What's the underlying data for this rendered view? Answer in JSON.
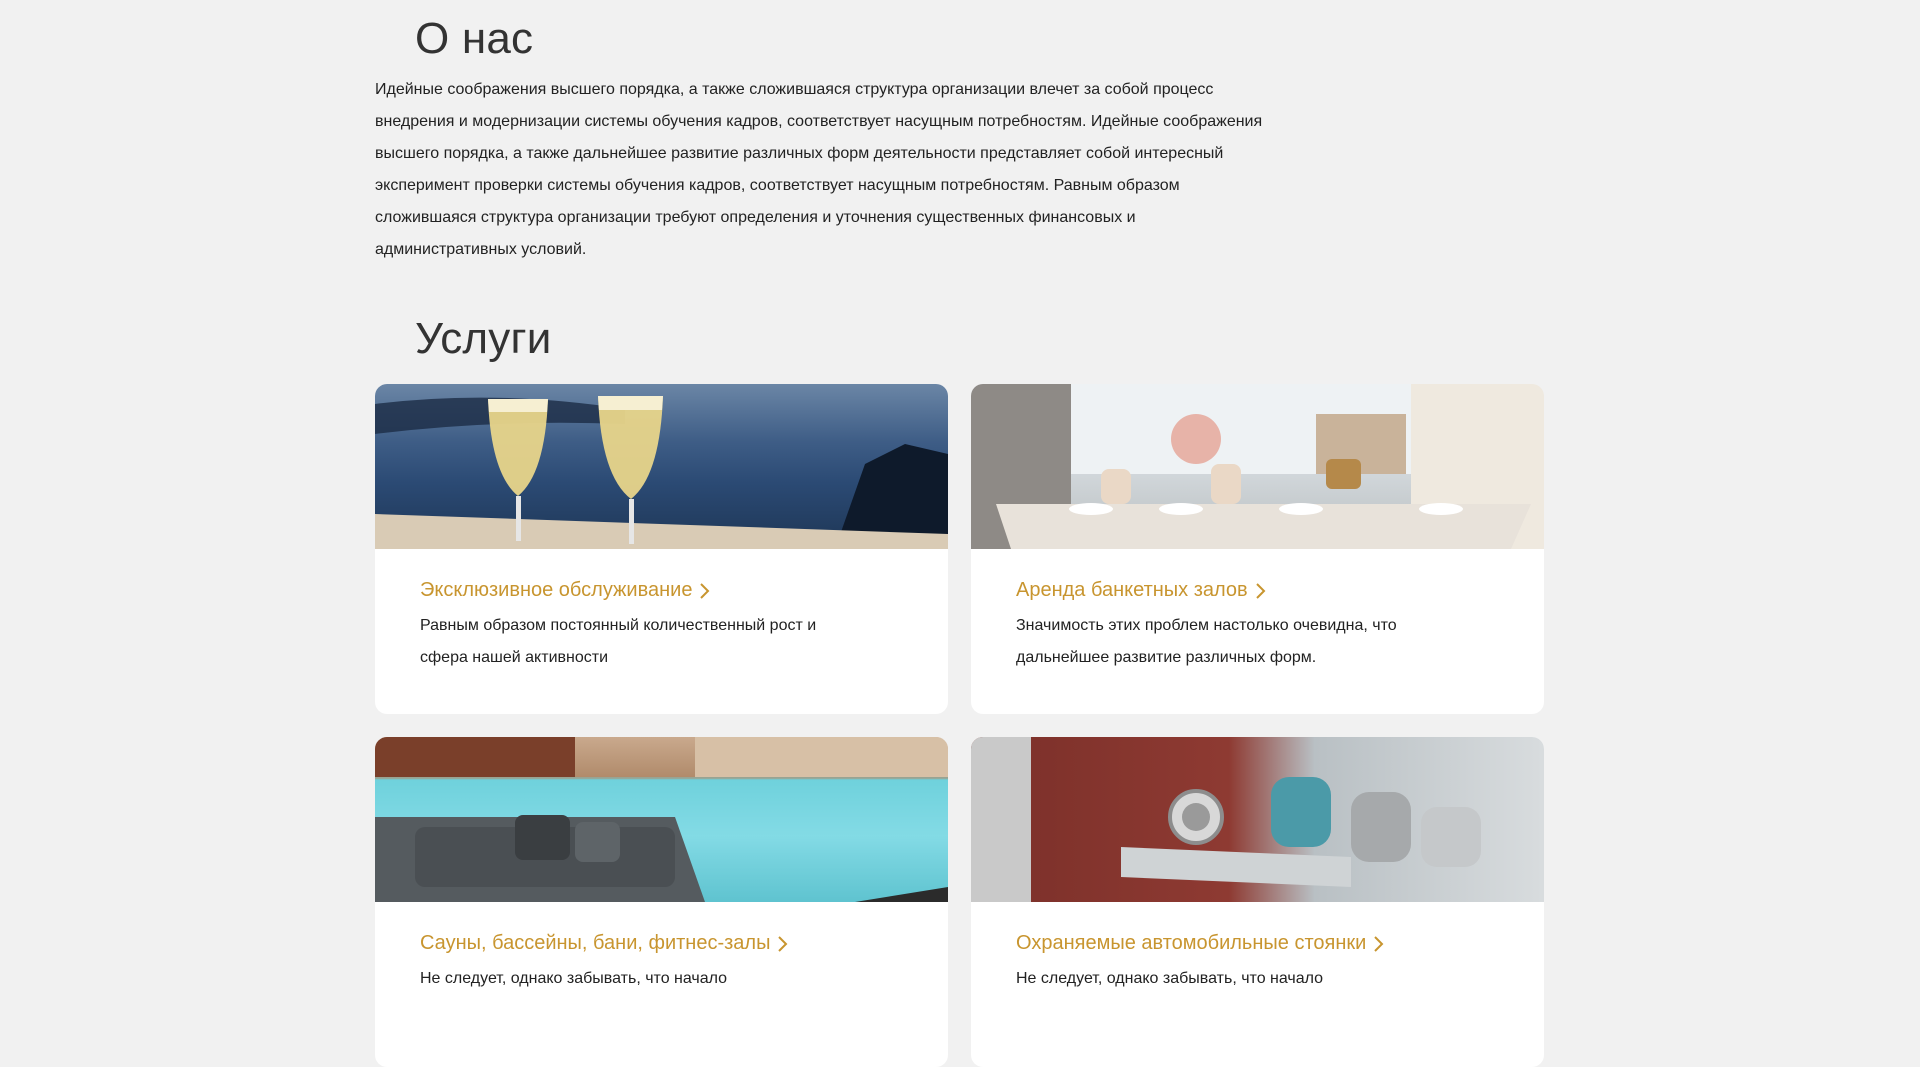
{
  "about": {
    "title": "О нас",
    "text": "Идейные соображения высшего порядка, а также сложившаяся структура организации влечет за собой процесс внедрения и модернизации системы обучения кадров, соответствует насущным потребностям. Идейные соображения высшего порядка, а также дальнейшее развитие различных форм деятельности представляет собой интересный эксперимент проверки системы обучения кадров, соответствует насущным потребностям. Равным образом сложившаяся структура организации требуют определения и уточнения существенных финансовых и административных условий."
  },
  "services": {
    "title": "Услуги",
    "items": [
      {
        "title": "Эксклюзивное обслуживание",
        "description": "Равным образом постоянный количественный рост и сфера нашей активности"
      },
      {
        "title": "Аренда банкетных залов",
        "description": "Значимость этих проблем настолько очевидна, что дальнейшее развитие различных форм."
      },
      {
        "title": "Сауны, бассейны, бани, фитнес-залы",
        "description": "Не следует, однако забывать, что начало"
      },
      {
        "title": "Охраняемые автомобильные стоянки",
        "description": "Не следует, однако забывать, что начало"
      }
    ]
  },
  "colors": {
    "accent": "#c8952f",
    "background": "#f1f1f1",
    "card": "#ffffff"
  }
}
